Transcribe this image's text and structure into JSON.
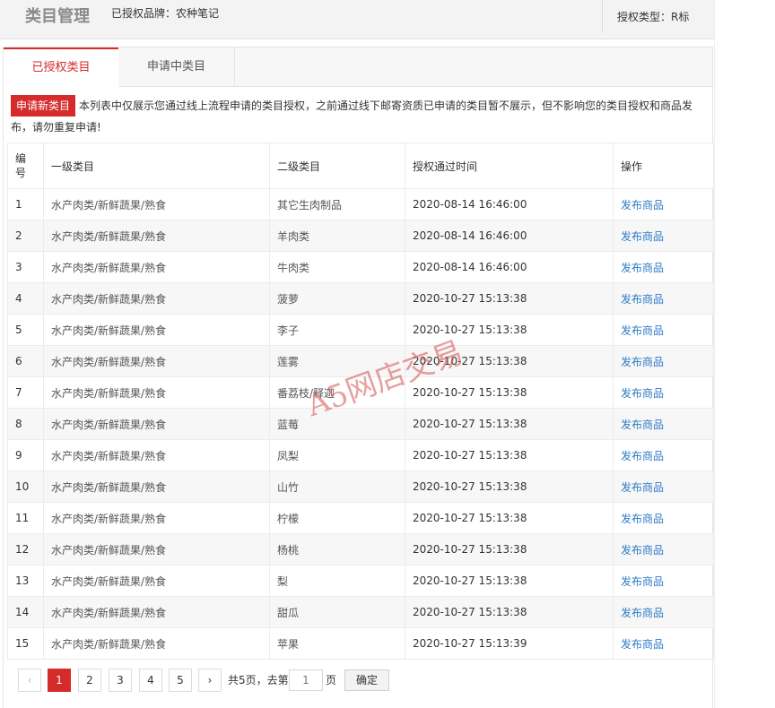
{
  "header": {
    "title": "类目管理",
    "brand": "已授权品牌：农种笔记",
    "auth_type": "授权类型：R标"
  },
  "tabs": [
    {
      "label": "已授权类目",
      "active": true
    },
    {
      "label": "申请中类目",
      "active": false
    }
  ],
  "notice": {
    "apply_button": "申请新类目",
    "text": "本列表中仅展示您通过线上流程申请的类目授权，之前通过线下邮寄资质已申请的类目暂不展示，但不影响您的类目授权和商品发布，请勿重复申请!"
  },
  "table": {
    "columns": [
      "编号",
      "一级类目",
      "二级类目",
      "授权通过时间",
      "操作"
    ],
    "rows": [
      {
        "id": "1",
        "level1": "水产肉类/新鲜蔬果/熟食",
        "level2": "其它生肉制品",
        "time": "2020-08-14 16:46:00",
        "action": "发布商品"
      },
      {
        "id": "2",
        "level1": "水产肉类/新鲜蔬果/熟食",
        "level2": "羊肉类",
        "time": "2020-08-14 16:46:00",
        "action": "发布商品"
      },
      {
        "id": "3",
        "level1": "水产肉类/新鲜蔬果/熟食",
        "level2": "牛肉类",
        "time": "2020-08-14 16:46:00",
        "action": "发布商品"
      },
      {
        "id": "4",
        "level1": "水产肉类/新鲜蔬果/熟食",
        "level2": "菠萝",
        "time": "2020-10-27 15:13:38",
        "action": "发布商品"
      },
      {
        "id": "5",
        "level1": "水产肉类/新鲜蔬果/熟食",
        "level2": "李子",
        "time": "2020-10-27 15:13:38",
        "action": "发布商品"
      },
      {
        "id": "6",
        "level1": "水产肉类/新鲜蔬果/熟食",
        "level2": "莲雾",
        "time": "2020-10-27 15:13:38",
        "action": "发布商品"
      },
      {
        "id": "7",
        "level1": "水产肉类/新鲜蔬果/熟食",
        "level2": "番荔枝/释迦",
        "time": "2020-10-27 15:13:38",
        "action": "发布商品"
      },
      {
        "id": "8",
        "level1": "水产肉类/新鲜蔬果/熟食",
        "level2": "蓝莓",
        "time": "2020-10-27 15:13:38",
        "action": "发布商品"
      },
      {
        "id": "9",
        "level1": "水产肉类/新鲜蔬果/熟食",
        "level2": "凤梨",
        "time": "2020-10-27 15:13:38",
        "action": "发布商品"
      },
      {
        "id": "10",
        "level1": "水产肉类/新鲜蔬果/熟食",
        "level2": "山竹",
        "time": "2020-10-27 15:13:38",
        "action": "发布商品"
      },
      {
        "id": "11",
        "level1": "水产肉类/新鲜蔬果/熟食",
        "level2": "柠檬",
        "time": "2020-10-27 15:13:38",
        "action": "发布商品"
      },
      {
        "id": "12",
        "level1": "水产肉类/新鲜蔬果/熟食",
        "level2": "杨桃",
        "time": "2020-10-27 15:13:38",
        "action": "发布商品"
      },
      {
        "id": "13",
        "level1": "水产肉类/新鲜蔬果/熟食",
        "level2": "梨",
        "time": "2020-10-27 15:13:38",
        "action": "发布商品"
      },
      {
        "id": "14",
        "level1": "水产肉类/新鲜蔬果/熟食",
        "level2": "甜瓜",
        "time": "2020-10-27 15:13:38",
        "action": "发布商品"
      },
      {
        "id": "15",
        "level1": "水产肉类/新鲜蔬果/熟食",
        "level2": "苹果",
        "time": "2020-10-27 15:13:39",
        "action": "发布商品"
      }
    ]
  },
  "watermark": "A5网店交易",
  "pagination": {
    "prev_icon": "chevron-left-icon",
    "next_icon": "chevron-right-icon",
    "prev_glyph": "‹",
    "next_glyph": "›",
    "pages": [
      "1",
      "2",
      "3",
      "4",
      "5"
    ],
    "current_page": "1",
    "total_text": "共5页，去第",
    "page_input_value": "1",
    "page_suffix": "页",
    "go_label": "确定"
  },
  "colors": {
    "accent": "#d62b2b",
    "link": "#2e7bc6"
  }
}
